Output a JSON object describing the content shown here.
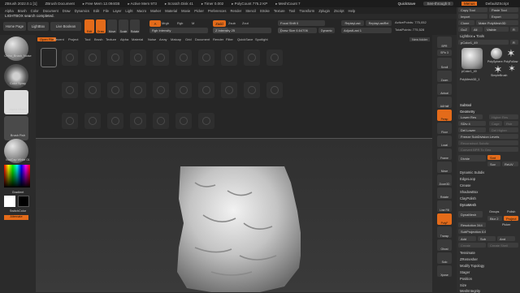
{
  "titlebar": {
    "app": "ZBrush 2022.0.1 [1]",
    "doc": "ZBrush Document",
    "freemem": "▸ Free Mem 12.094GB",
    "activemem": "▸ Active Mem 973",
    "scratch": "▸ Scratch Disk 41",
    "timer": "▸ Timer 0.002",
    "polycount": "▸ PolyCount 775.2 KP",
    "meshcount": "▸ MeshCount 7",
    "quicksave": "QuickSave",
    "seethrough": "See-through 0",
    "menus": "Menus",
    "script": "DefaultZScript"
  },
  "menubar": [
    "Alpha",
    "Brush",
    "Color",
    "Document",
    "Draw",
    "Dynamics",
    "Edit",
    "File",
    "Layer",
    "Light",
    "Macro",
    "Marker",
    "Material",
    "Movie",
    "Picker",
    "Preferences",
    "Render",
    "Stencil",
    "Stroke",
    "Texture",
    "Tool",
    "Transform",
    "Zplugin",
    "Zscript",
    "Help"
  ],
  "status": "LIGHTBOX search completed.",
  "topbar": {
    "home": "Home Page",
    "lightbox": "LightBox",
    "liveboolean": "Live Boolean",
    "edit": "Edit",
    "draw": "Draw",
    "move": "Move",
    "scale": "Scale",
    "rotate": "Rotate",
    "a": "A",
    "mrgb": "Mrgb",
    "rgb": "Rgb",
    "m": "M",
    "zadd": "Zadd",
    "zsub": "Zsub",
    "zcut": "Zcut",
    "rgbintensity": "Rgb Intensity",
    "zintensity": "Z Intensity 25",
    "focalshift": "Focal Shift 0",
    "drawsize": "Draw Size 6.64706",
    "dynamic": "Dynamic",
    "replaylast": "ReplayLast",
    "replaylastrel": "ReplayLastRel",
    "activepoints": "ActivePoints: 775,052",
    "adjustlast": "AdjustLast 1",
    "totalpoints": "TotalPoints: 775,528"
  },
  "lightbox": {
    "tabs": [
      "Open File",
      "Recent",
      "Project",
      "Tool",
      "Brush",
      "Texture",
      "Alpha",
      "Material",
      "Noise",
      "Array",
      "Matcap",
      "Grid",
      "Document",
      "Render",
      "Filter",
      "QuickSave",
      "Spotlight"
    ],
    "new_folder": "New folder"
  },
  "leftshelf": {
    "brush": "Ortho_Brush_Noise",
    "stroke": "Color Spray",
    "alpha": "Alpha Mixed",
    "texture": "Brush Fish",
    "material": "MatCap White 01",
    "gradient": "Gradient",
    "switchcolor": "SwitchColor",
    "alternate": "Alternate"
  },
  "rightdock": [
    "BPR",
    "SPix 3",
    "Scroll",
    "Zoom",
    "Actual",
    "AAHalf",
    "Persp",
    "Floor",
    "Local",
    "Frame",
    "Move",
    "Zoom3D",
    "Rotate",
    "Line Fill",
    "PolyF",
    "Transp",
    "Ghost",
    "Solo",
    "Xpose"
  ],
  "rightpanel": {
    "copytool": "Copy Tool",
    "pastetool": "Paste Tool",
    "import": "Import",
    "export": "Export",
    "clone": "Clone",
    "makepolymesh": "Make PolyMesh3D",
    "goz": "GoZ",
    "all": "All",
    "visible": "Visible",
    "r": "R",
    "lightbox_tools": "Lightbox ▸ Tools",
    "pcolor": "pColor1_49",
    "r2": "R",
    "subtool_label": "pColor1_49",
    "polysphere": "PolySphere",
    "polyfollow": "PolyFollow",
    "simplebrush": "SimpleBrush",
    "polymesh": "PolyMesh3D_1",
    "subtool": "Subtool",
    "geometry": "Geometry",
    "lowerres": "Lower Res",
    "higherres": "Higher Res",
    "sdiv": "SDiv 4",
    "cage": "Cage",
    "rstr": "Rstr",
    "delower": "Del Lower",
    "delhigher": "Del Higher",
    "freezesub": "Freeze SubDivision Levels",
    "reconstruct": "Reconstruct Subdiv",
    "converttopoly": "Convert BPR To Geo",
    "divide": "Divide",
    "smt": "Smt",
    "suv": "Suv",
    "reuv": "ReUV",
    "dynamicsubdiv": "Dynamic Subdiv",
    "edgeloop": "EdgeLoop",
    "crease": "Crease",
    "shadowbox": "ShadowBox",
    "claypolish": "ClayPolish",
    "dynamesh": "DynaMesh",
    "dynamesh2": "DynaMesh",
    "groups": "Groups",
    "polish": "Polish",
    "blur": "Blur 2",
    "project": "Project",
    "resolution": "Resolution 344",
    "picker": "Picker",
    "subprojection": "SubProjection 0.6",
    "add": "Add",
    "sub": "Sub",
    "and": "And",
    "create": "Create",
    "createshell": "Create Shell",
    "tessimate": "Tessimate",
    "zremesher": "ZRemesher",
    "modifytopology": "Modify Topology",
    "stager": "Stager",
    "position": "Position",
    "size": "Size",
    "meshintegrity": "MeshIntegrity"
  },
  "colors": {
    "accent": "#e46b1a",
    "panel": "#2f2f2f",
    "canvas": "#303030"
  }
}
